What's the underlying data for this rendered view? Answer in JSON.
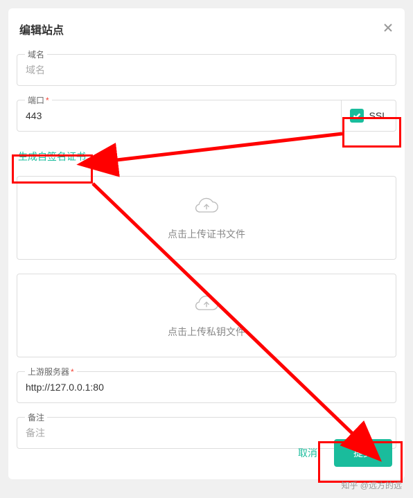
{
  "modal": {
    "title": "编辑站点",
    "domain_label": "域名",
    "domain_placeholder": "域名",
    "port_label": "端口",
    "port_value": "443",
    "ssl_label": "SSL",
    "ssl_checked": true,
    "gen_cert": "生成自签名证书",
    "upload_cert": "点击上传证书文件",
    "upload_key": "点击上传私钥文件",
    "upstream_label": "上游服务器",
    "upstream_value": "http://127.0.0.1:80",
    "remark_label": "备注",
    "remark_placeholder": "备注",
    "cancel": "取消",
    "submit": "提交"
  },
  "watermark": "知乎 @远方的远"
}
